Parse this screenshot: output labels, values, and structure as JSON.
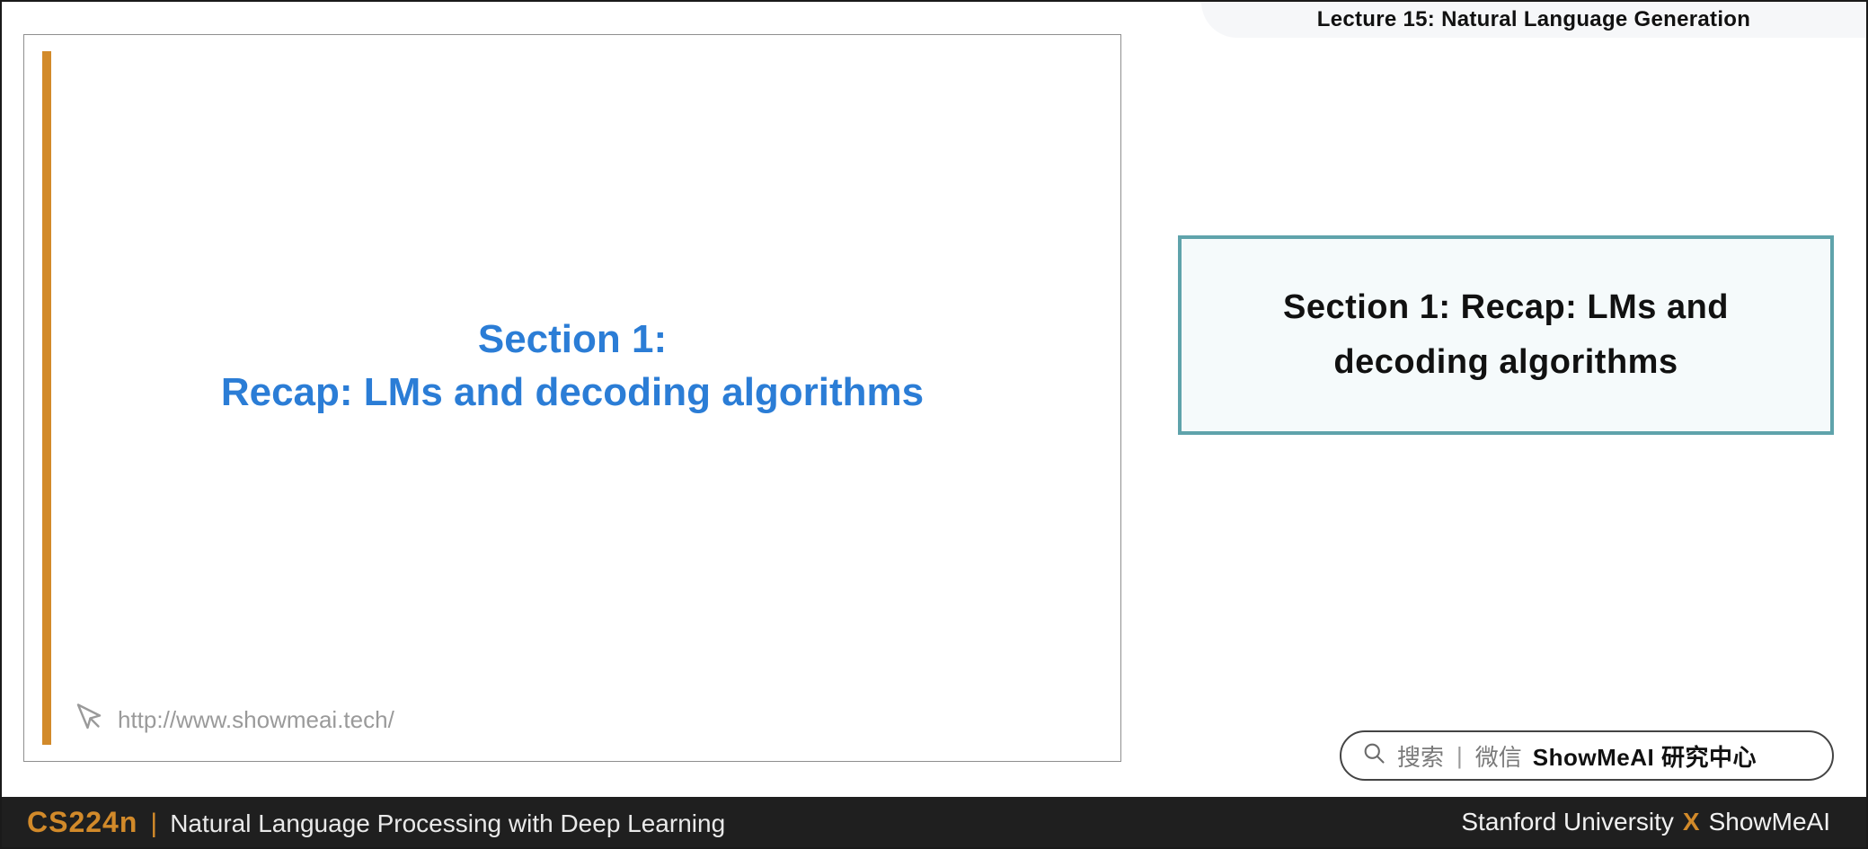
{
  "header": {
    "lecture_label": "Lecture 15: Natural Language Generation"
  },
  "slide": {
    "title_line1": "Section 1:",
    "title_line2": "Recap: LMs and decoding algorithms",
    "link_url": "http://www.showmeai.tech/"
  },
  "callout": {
    "text": "Section 1: Recap: LMs and decoding algorithms"
  },
  "search": {
    "hint1": "搜索",
    "hint2": "微信",
    "brand": "ShowMeAI 研究中心"
  },
  "footer": {
    "course_code": "CS224n",
    "course_subtitle": "Natural Language Processing with Deep Learning",
    "university": "Stanford University",
    "x": "X",
    "organization": "ShowMeAI"
  }
}
